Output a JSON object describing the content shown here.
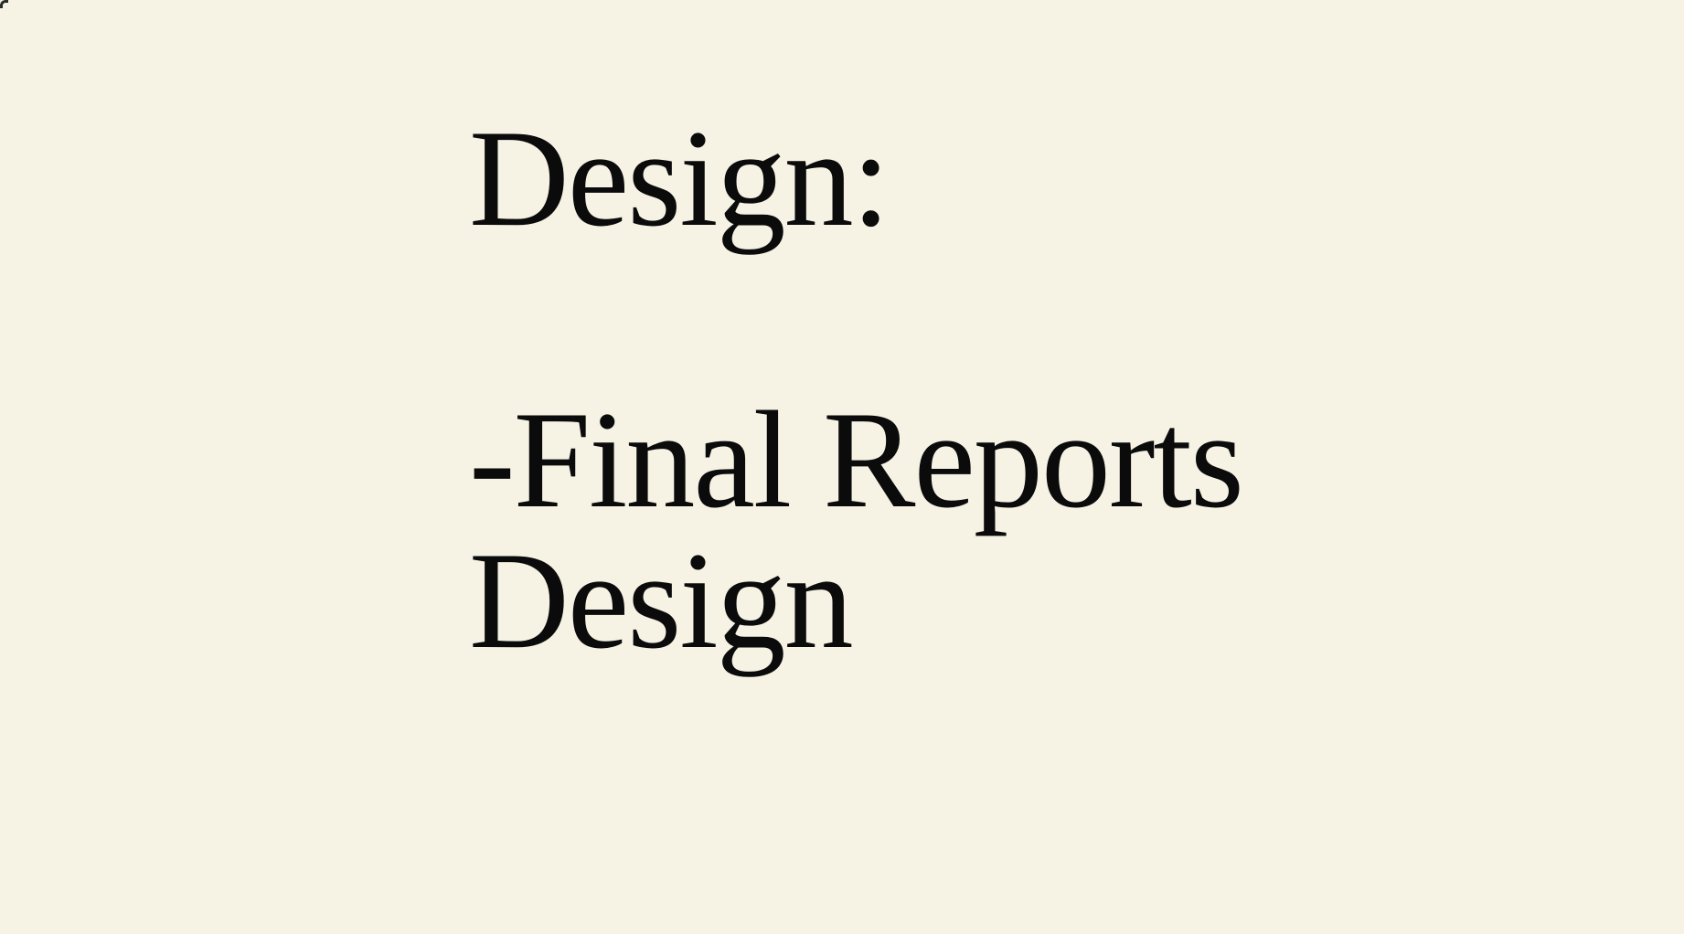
{
  "slide": {
    "heading": "Design:",
    "items": [
      "-Final Reports",
      "Design"
    ],
    "background_color": "#f6f3e5",
    "text_color": "#0b0b0b"
  }
}
